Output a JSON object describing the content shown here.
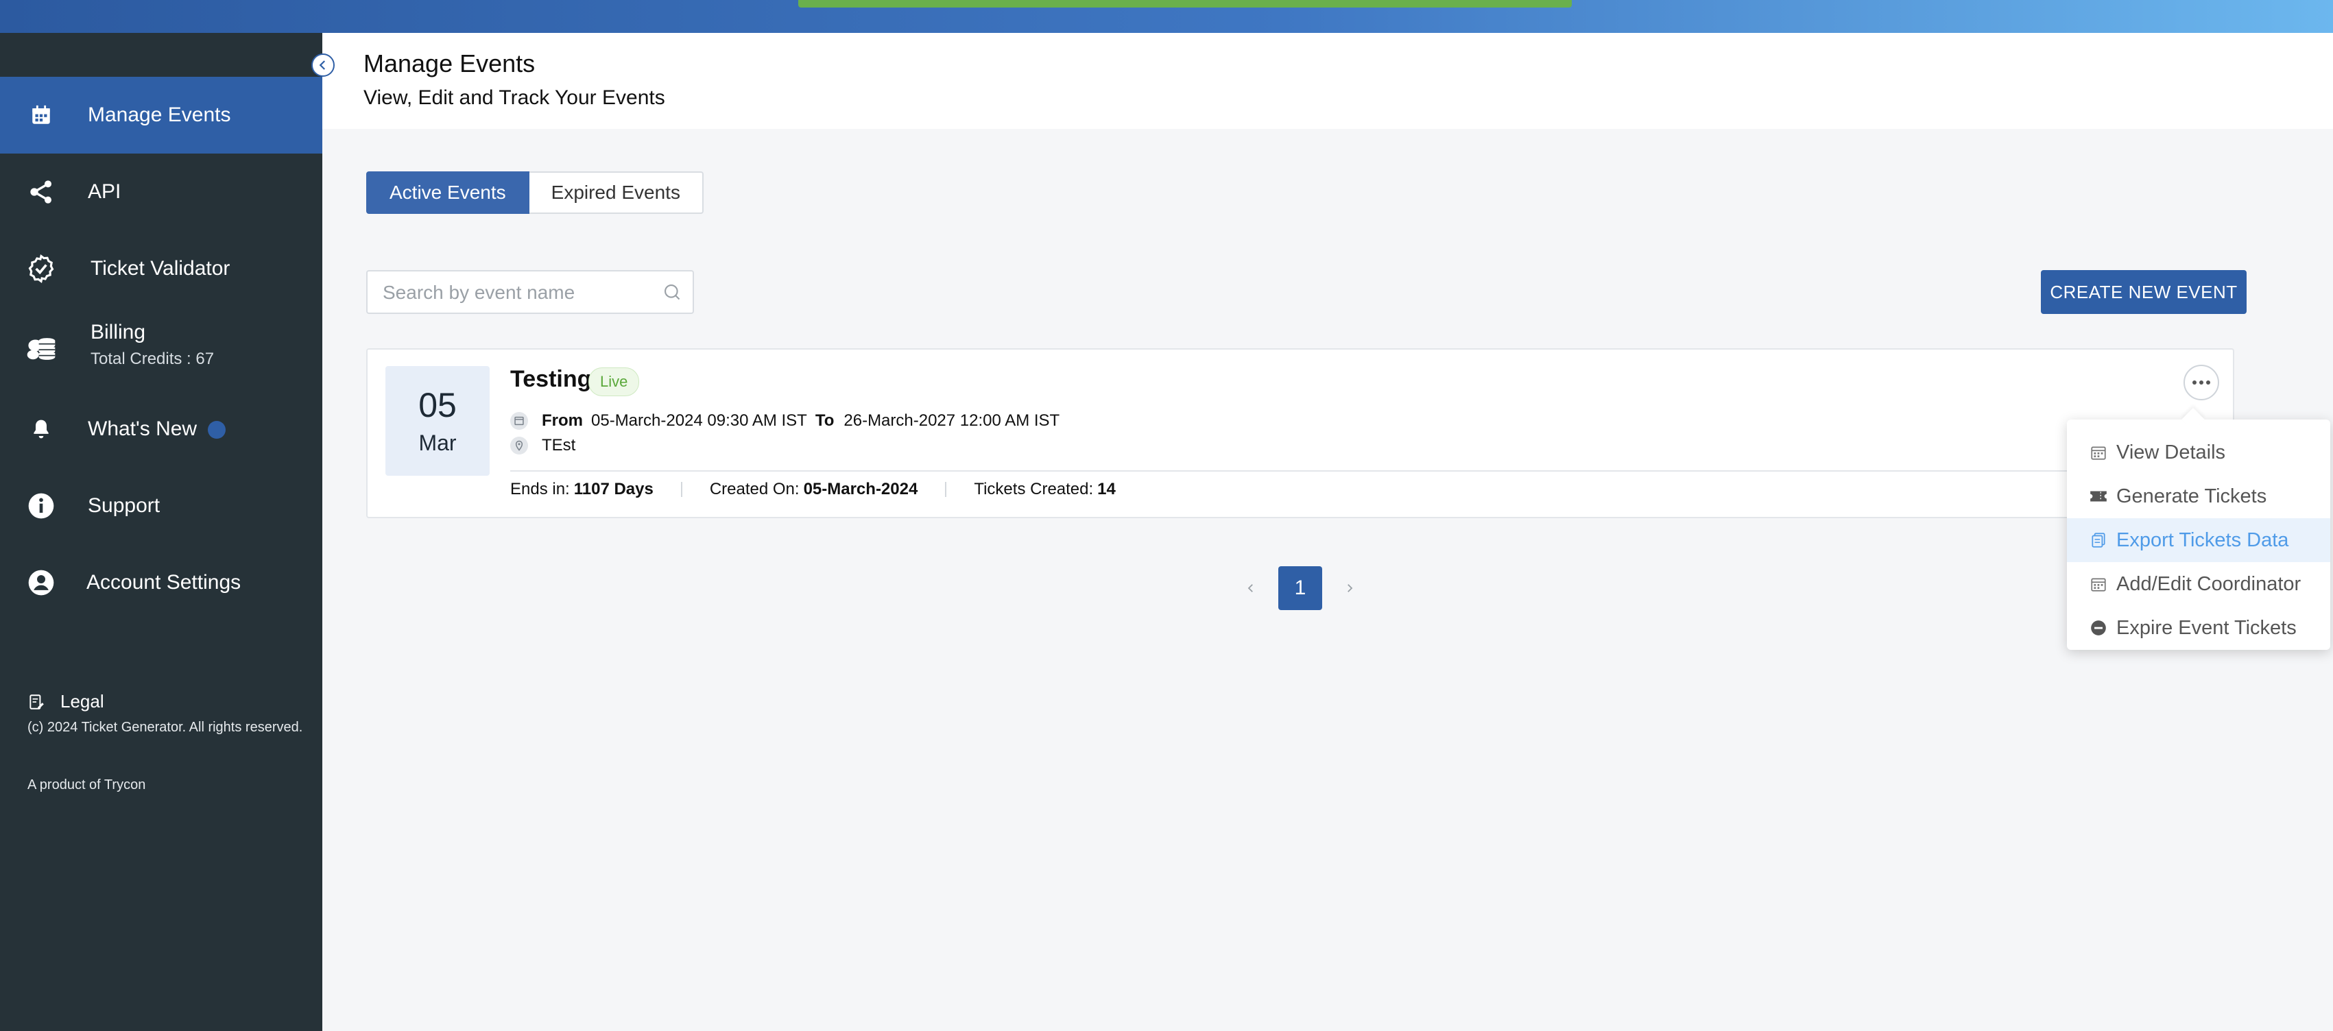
{
  "sidebar": {
    "items": [
      {
        "label": "Manage Events",
        "icon": "calendar-icon",
        "active": true
      },
      {
        "label": "API",
        "icon": "share-icon"
      },
      {
        "label": "Ticket Validator",
        "icon": "badge-check-icon"
      },
      {
        "label": "Billing",
        "icon": "coins-icon",
        "sub": "Total Credits : 67"
      },
      {
        "label": "What's New",
        "icon": "bell-icon"
      },
      {
        "label": "Support",
        "icon": "info-icon"
      },
      {
        "label": "Account Settings",
        "icon": "account-icon"
      }
    ],
    "legal": "Legal",
    "copyright": "(c) 2024 Ticket Generator. All rights reserved.",
    "product": "A product of Trycon"
  },
  "header": {
    "title": "Manage Events",
    "subtitle": "View, Edit and Track Your Events"
  },
  "tabs": {
    "active": "Active Events",
    "expired": "Expired Events"
  },
  "search": {
    "placeholder": "Search by event name",
    "value": ""
  },
  "create_button": "CREATE NEW EVENT",
  "event": {
    "day": "05",
    "month": "Mar",
    "title": "Testing",
    "status": "Live",
    "from_label": "From",
    "from": "05-March-2024 09:30 AM IST",
    "to_label": "To",
    "to": "26-March-2027 12:00 AM IST",
    "location": "TEst",
    "ends_label": "Ends in:",
    "ends_value": "1107 Days",
    "created_label": "Created On:",
    "created_value": "05-March-2024",
    "tickets_label": "Tickets Created:",
    "tickets_value": "14"
  },
  "menu": {
    "items": [
      {
        "label": "View Details",
        "icon": "calendar-icon"
      },
      {
        "label": "Generate Tickets",
        "icon": "ticket-icon"
      },
      {
        "label": "Export Tickets Data",
        "icon": "export-icon",
        "highlighted": true
      },
      {
        "label": "Add/Edit Coordinator",
        "icon": "calendar-icon"
      },
      {
        "label": "Expire Event Tickets",
        "icon": "minus-circle-icon"
      }
    ]
  },
  "pagination": {
    "current": "1"
  },
  "colors": {
    "primary": "#2f5fa6",
    "sidebar": "#263238",
    "live": "#5aa83a",
    "progress": "#6ab04c",
    "highlight_text": "#4f9be8"
  }
}
